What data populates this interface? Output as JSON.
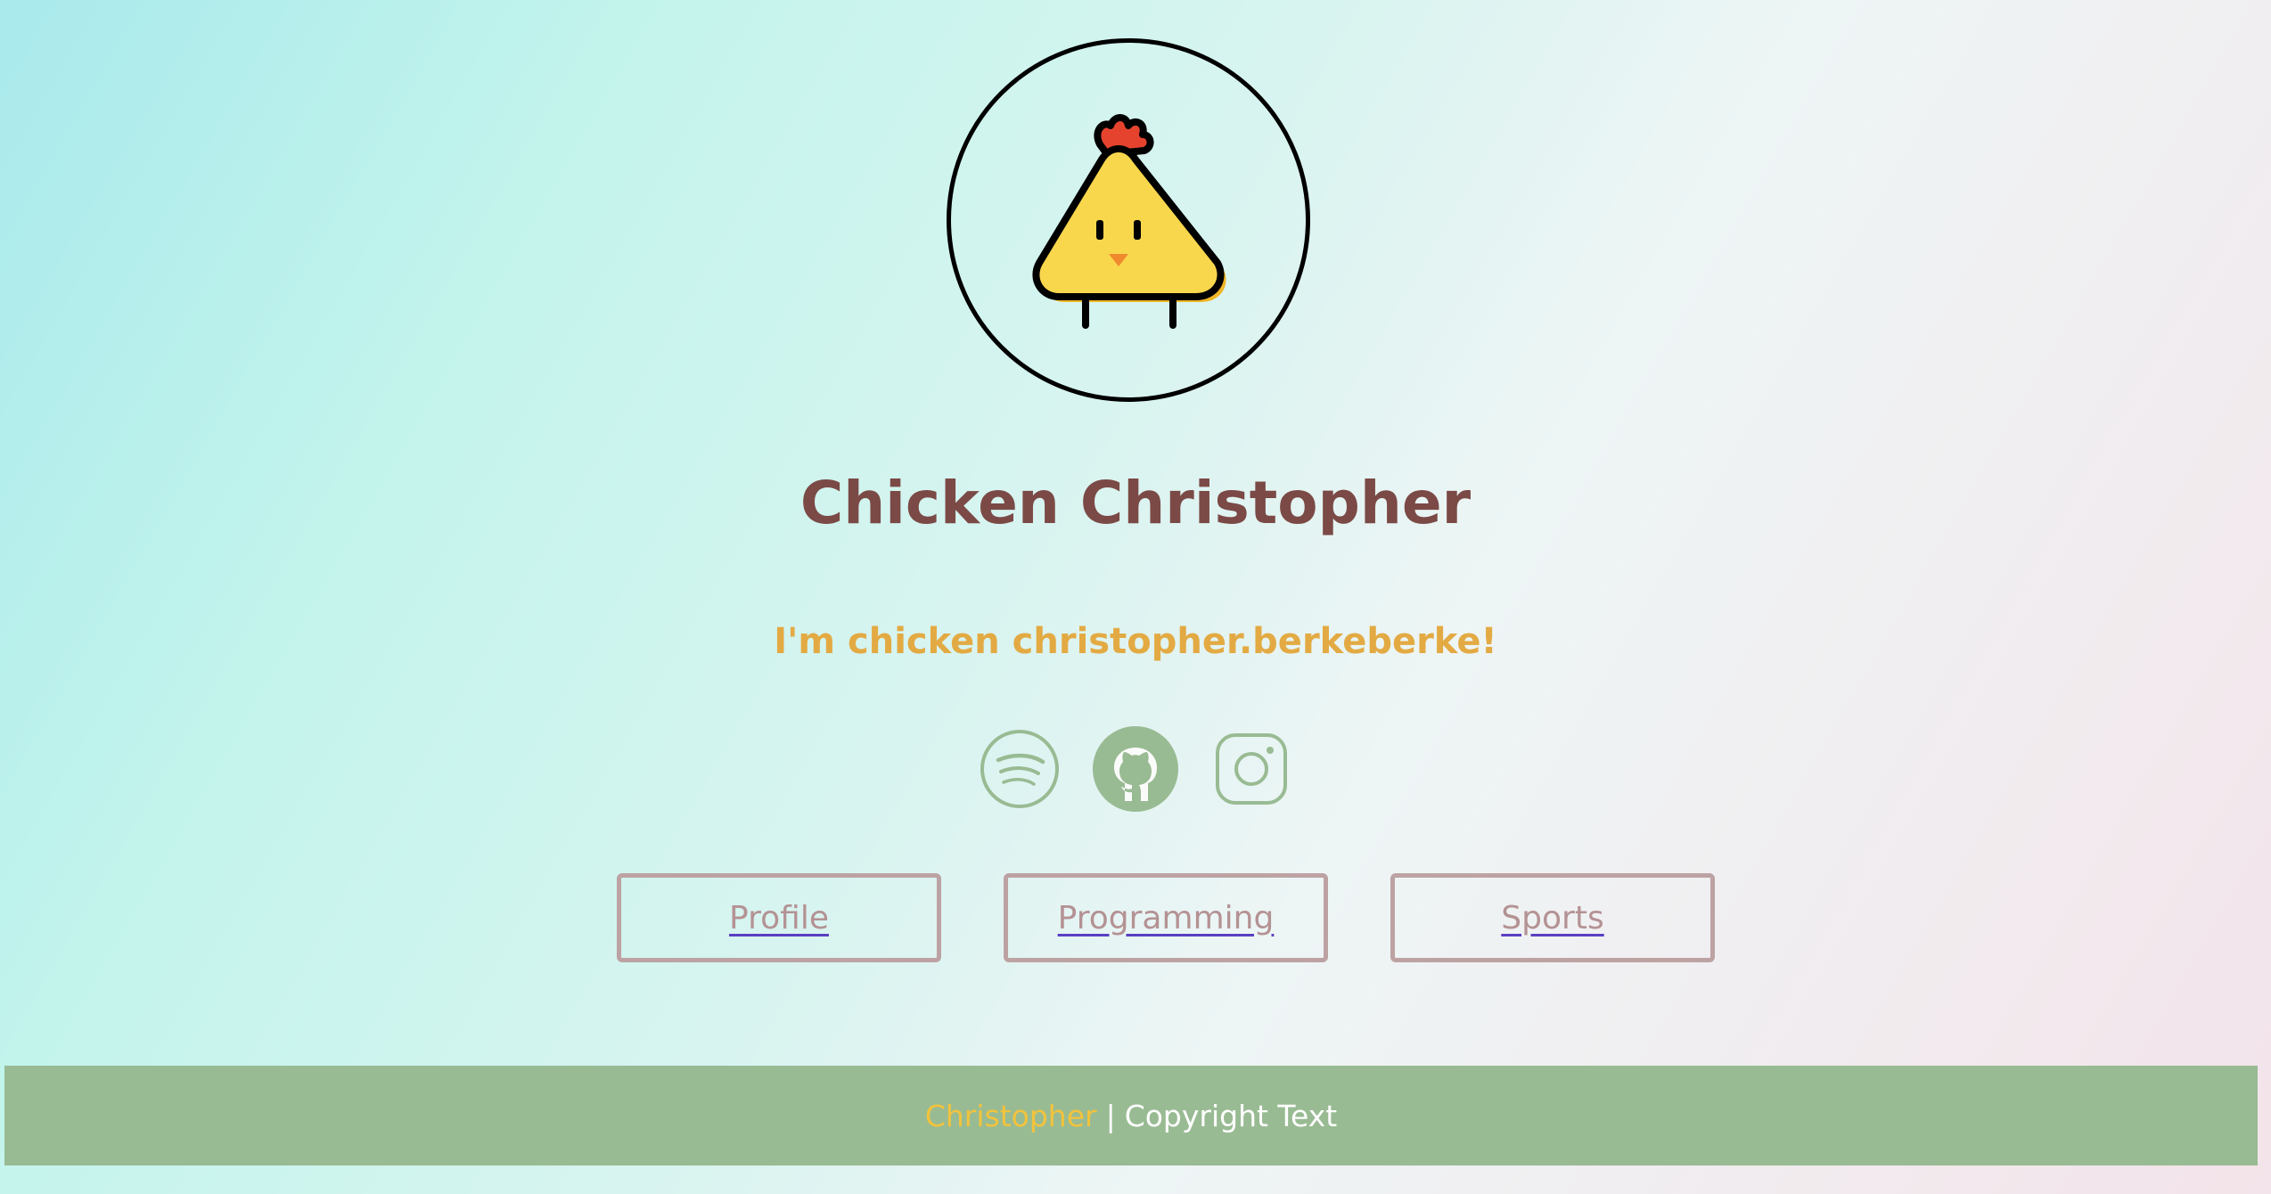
{
  "profile": {
    "name": "Chicken Christopher",
    "tagline": "I'm chicken christopher.berkeberke!"
  },
  "socials": [
    {
      "icon": "spotify-icon"
    },
    {
      "icon": "github-icon"
    },
    {
      "icon": "instagram-icon"
    }
  ],
  "nav": {
    "profile_label": "Profile",
    "programming_label": "Programming",
    "sports_label": "Sports"
  },
  "footer": {
    "brand": "Christopher",
    "separator": "|",
    "copyright": "Copyright Text"
  },
  "colors": {
    "name": "#7b4a46",
    "tagline": "#e3aa43",
    "icon": "#99bb93",
    "button_border": "#bda2a4",
    "footer_bg": "#99bb93",
    "footer_brand": "#f2c33c"
  }
}
